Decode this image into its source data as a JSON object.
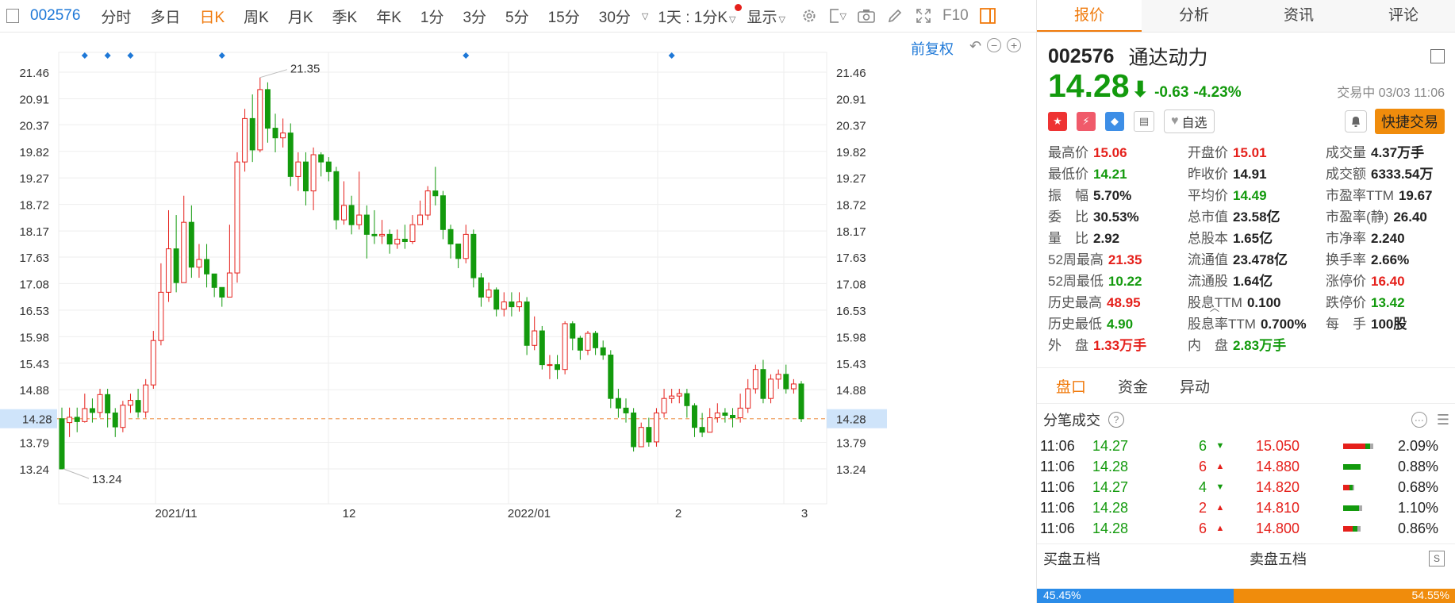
{
  "toolbar": {
    "code": "002576",
    "periods": [
      "分时",
      "多日",
      "日K",
      "周K",
      "月K",
      "季K",
      "年K",
      "1分",
      "3分",
      "5分",
      "15分",
      "30分"
    ],
    "active_period": "日K",
    "interval_select": "1天 : 1分K",
    "display_label": "显示",
    "f10_label": "F10"
  },
  "chart": {
    "fuquan_label": "前复权",
    "price_ticks": [
      "21.46",
      "20.91",
      "20.37",
      "19.82",
      "19.27",
      "18.72",
      "18.17",
      "17.63",
      "17.08",
      "16.53",
      "15.98",
      "15.43",
      "14.88",
      "14.28",
      "13.79",
      "13.24"
    ],
    "date_labels": [
      "2021/11",
      "12",
      "2022/01",
      "2",
      "3"
    ],
    "high_label": "21.35",
    "low_label": "13.24",
    "current_price_tag": "14.28",
    "colors": {
      "up": "#e5201b",
      "down": "#139a0d",
      "grid": "#eeeeee",
      "current_line": "#f0a060",
      "current_tag_bg": "#cfe4fa",
      "marker": "#1e78d7"
    }
  },
  "chart_data": {
    "type": "candlestick",
    "ylim": [
      13.0,
      21.7
    ],
    "marker_indices": [
      3,
      6,
      9,
      21,
      53,
      80
    ],
    "candles": [
      [
        14.28,
        13.24,
        14.51,
        13.24
      ],
      [
        14.2,
        14.31,
        14.51,
        13.9
      ],
      [
        14.31,
        14.22,
        14.51,
        14.0
      ],
      [
        14.22,
        14.49,
        14.8,
        14.2
      ],
      [
        14.49,
        14.41,
        14.7,
        14.2
      ],
      [
        14.41,
        14.78,
        14.9,
        14.3
      ],
      [
        14.78,
        14.4,
        14.9,
        14.1
      ],
      [
        14.4,
        14.11,
        14.5,
        13.9
      ],
      [
        14.1,
        14.56,
        14.65,
        14.0
      ],
      [
        14.56,
        14.66,
        14.8,
        14.4
      ],
      [
        14.66,
        14.42,
        14.9,
        14.3
      ],
      [
        14.42,
        14.98,
        15.1,
        14.3
      ],
      [
        14.98,
        15.9,
        16.1,
        14.9
      ],
      [
        15.9,
        16.9,
        17.5,
        15.8
      ],
      [
        16.9,
        17.8,
        18.6,
        16.7
      ],
      [
        17.8,
        17.1,
        18.5,
        16.9
      ],
      [
        17.1,
        18.35,
        18.9,
        17.1
      ],
      [
        18.35,
        17.42,
        18.7,
        17.2
      ],
      [
        17.42,
        17.58,
        17.9,
        17.2
      ],
      [
        17.58,
        17.28,
        17.9,
        17.0
      ],
      [
        17.28,
        17.0,
        17.2,
        16.8
      ],
      [
        17.0,
        16.8,
        17.0,
        16.6
      ],
      [
        16.8,
        17.3,
        18.3,
        16.8
      ],
      [
        17.3,
        19.6,
        19.8,
        17.1
      ],
      [
        19.6,
        20.5,
        20.7,
        19.4
      ],
      [
        20.5,
        19.85,
        21.0,
        19.6
      ],
      [
        19.85,
        21.1,
        21.35,
        19.8
      ],
      [
        21.1,
        20.3,
        21.25,
        20.0
      ],
      [
        20.3,
        20.1,
        20.6,
        19.8
      ],
      [
        20.1,
        20.2,
        20.5,
        19.9
      ],
      [
        20.2,
        19.3,
        20.4,
        19.1
      ],
      [
        19.3,
        19.6,
        19.8,
        19.0
      ],
      [
        19.6,
        19.0,
        19.8,
        18.7
      ],
      [
        19.0,
        19.75,
        19.9,
        18.6
      ],
      [
        19.75,
        19.6,
        19.8,
        19.3
      ],
      [
        19.6,
        19.4,
        19.7,
        19.2
      ],
      [
        19.4,
        18.4,
        19.5,
        18.2
      ],
      [
        18.4,
        18.7,
        19.2,
        18.3
      ],
      [
        18.7,
        18.3,
        18.9,
        18.1
      ],
      [
        18.3,
        18.5,
        19.4,
        18.2
      ],
      [
        18.5,
        18.1,
        18.7,
        17.6
      ],
      [
        18.1,
        18.07,
        18.6,
        17.9
      ],
      [
        18.07,
        18.1,
        18.4,
        17.9
      ],
      [
        18.1,
        17.9,
        18.2,
        17.7
      ],
      [
        17.9,
        18.0,
        18.2,
        17.8
      ],
      [
        18.0,
        17.95,
        18.3,
        17.8
      ],
      [
        17.95,
        18.3,
        18.5,
        17.9
      ],
      [
        18.3,
        18.5,
        18.8,
        18.3
      ],
      [
        18.5,
        19.0,
        19.1,
        18.4
      ],
      [
        19.0,
        18.9,
        19.5,
        18.7
      ],
      [
        18.9,
        18.2,
        19.0,
        18.0
      ],
      [
        18.2,
        17.9,
        18.3,
        17.6
      ],
      [
        17.9,
        17.6,
        17.9,
        17.4
      ],
      [
        17.6,
        18.1,
        18.3,
        17.5
      ],
      [
        18.1,
        17.2,
        18.2,
        17.0
      ],
      [
        17.2,
        16.8,
        17.3,
        16.6
      ],
      [
        16.8,
        16.95,
        17.1,
        16.7
      ],
      [
        16.95,
        16.55,
        17.0,
        16.4
      ],
      [
        16.55,
        16.7,
        16.9,
        16.4
      ],
      [
        16.7,
        16.6,
        16.9,
        16.4
      ],
      [
        16.6,
        16.7,
        16.9,
        16.5
      ],
      [
        16.7,
        15.8,
        16.8,
        15.6
      ],
      [
        15.8,
        16.1,
        16.4,
        15.7
      ],
      [
        16.1,
        15.4,
        16.2,
        15.3
      ],
      [
        15.4,
        15.4,
        15.6,
        15.1
      ],
      [
        15.4,
        15.3,
        15.6,
        15.1
      ],
      [
        15.3,
        16.25,
        16.3,
        15.2
      ],
      [
        16.25,
        15.95,
        16.3,
        15.7
      ],
      [
        15.95,
        15.7,
        16.0,
        15.5
      ],
      [
        15.7,
        16.05,
        16.1,
        15.6
      ],
      [
        16.05,
        15.75,
        16.1,
        15.6
      ],
      [
        15.75,
        15.6,
        15.9,
        15.5
      ],
      [
        15.6,
        14.7,
        15.7,
        14.5
      ],
      [
        14.7,
        14.5,
        14.9,
        14.3
      ],
      [
        14.5,
        14.4,
        14.7,
        14.2
      ],
      [
        14.4,
        13.7,
        14.5,
        13.6
      ],
      [
        13.7,
        14.1,
        14.2,
        13.7
      ],
      [
        14.1,
        13.8,
        14.3,
        13.7
      ],
      [
        13.8,
        14.4,
        14.5,
        13.7
      ],
      [
        14.4,
        14.7,
        14.9,
        14.3
      ],
      [
        14.7,
        14.75,
        14.9,
        14.6
      ],
      [
        14.75,
        14.8,
        14.9,
        14.6
      ],
      [
        14.8,
        14.55,
        14.9,
        14.3
      ],
      [
        14.55,
        14.1,
        14.6,
        13.9
      ],
      [
        14.1,
        14.0,
        14.4,
        13.9
      ],
      [
        14.0,
        14.3,
        14.5,
        14.0
      ],
      [
        14.3,
        14.4,
        14.6,
        14.2
      ],
      [
        14.4,
        14.35,
        14.5,
        14.2
      ],
      [
        14.35,
        14.3,
        14.5,
        14.1
      ],
      [
        14.3,
        14.5,
        14.8,
        14.2
      ],
      [
        14.5,
        14.9,
        15.1,
        14.4
      ],
      [
        14.9,
        15.3,
        15.4,
        14.8
      ],
      [
        15.3,
        14.7,
        15.5,
        14.6
      ],
      [
        14.7,
        15.1,
        15.2,
        14.6
      ],
      [
        15.1,
        15.2,
        15.3,
        14.9
      ],
      [
        15.2,
        14.9,
        15.4,
        14.8
      ],
      [
        14.9,
        15.0,
        15.1,
        14.8
      ],
      [
        15.0,
        14.28,
        15.06,
        14.21
      ]
    ]
  },
  "panel": {
    "tabs": [
      "报价",
      "分析",
      "资讯",
      "评论"
    ],
    "active_tab": "报价",
    "code": "002576",
    "name": "通达动力",
    "price": "14.28",
    "change": "-0.63",
    "change_pct": "-4.23%",
    "status_time": "交易中 03/03 11:06",
    "watch_label": "自选",
    "fast_trade_label": "快捷交易",
    "stats": [
      {
        "label": "最高价",
        "value": "15.06",
        "color": "red"
      },
      {
        "label": "开盘价",
        "value": "15.01",
        "color": "red"
      },
      {
        "label": "成交量",
        "value": "4.37万手",
        "color": "black"
      },
      {
        "label": "最低价",
        "value": "14.21",
        "color": "green"
      },
      {
        "label": "昨收价",
        "value": "14.91",
        "color": "black"
      },
      {
        "label": "成交额",
        "value": "6333.54万",
        "color": "black"
      },
      {
        "label": "振　幅",
        "value": "5.70%",
        "color": "black"
      },
      {
        "label": "平均价",
        "value": "14.49",
        "color": "green"
      },
      {
        "label": "市盈率TTM",
        "value": "19.67",
        "color": "black"
      },
      {
        "label": "委　比",
        "value": "30.53%",
        "color": "black"
      },
      {
        "label": "总市值",
        "value": "23.58亿",
        "color": "black"
      },
      {
        "label": "市盈率(静)",
        "value": "26.40",
        "color": "black"
      },
      {
        "label": "量　比",
        "value": "2.92",
        "color": "black"
      },
      {
        "label": "总股本",
        "value": "1.65亿",
        "color": "black"
      },
      {
        "label": "市净率",
        "value": "2.240",
        "color": "black"
      },
      {
        "label": "52周最高",
        "value": "21.35",
        "color": "red"
      },
      {
        "label": "流通值",
        "value": "23.478亿",
        "color": "black"
      },
      {
        "label": "换手率",
        "value": "2.66%",
        "color": "black"
      },
      {
        "label": "52周最低",
        "value": "10.22",
        "color": "green"
      },
      {
        "label": "流通股",
        "value": "1.64亿",
        "color": "black"
      },
      {
        "label": "涨停价",
        "value": "16.40",
        "color": "red"
      },
      {
        "label": "历史最高",
        "value": "48.95",
        "color": "red"
      },
      {
        "label": "股息TTM",
        "value": "0.100",
        "color": "black"
      },
      {
        "label": "跌停价",
        "value": "13.42",
        "color": "green"
      },
      {
        "label": "历史最低",
        "value": "4.90",
        "color": "green"
      },
      {
        "label": "股息率TTM",
        "value": "0.700%",
        "color": "black"
      },
      {
        "label": "每　手",
        "value": "100股",
        "color": "black"
      },
      {
        "label": "外　盘",
        "value": "1.33万手",
        "color": "red"
      },
      {
        "label": "内　盘",
        "value": "2.83万手",
        "color": "green"
      }
    ],
    "subtabs": [
      "盘口",
      "资金",
      "异动"
    ],
    "active_subtab": "盘口",
    "ticks_title": "分笔成交",
    "ticks": [
      {
        "time": "11:06",
        "price": "14.27",
        "vol": "6",
        "dir": "down",
        "price2": "15.050",
        "pct": "2.09%"
      },
      {
        "time": "11:06",
        "price": "14.28",
        "vol": "6",
        "dir": "up",
        "price2": "14.880",
        "pct": "0.88%"
      },
      {
        "time": "11:06",
        "price": "14.27",
        "vol": "4",
        "dir": "down",
        "price2": "14.820",
        "pct": "0.68%"
      },
      {
        "time": "11:06",
        "price": "14.28",
        "vol": "2",
        "dir": "up",
        "price2": "14.810",
        "pct": "1.10%"
      },
      {
        "time": "11:06",
        "price": "14.28",
        "vol": "6",
        "dir": "up",
        "price2": "14.800",
        "pct": "0.86%"
      }
    ],
    "buy_label": "买盘五档",
    "sell_label": "卖盘五档",
    "buy_ratio": "45.45%",
    "sell_ratio": "54.55%"
  }
}
